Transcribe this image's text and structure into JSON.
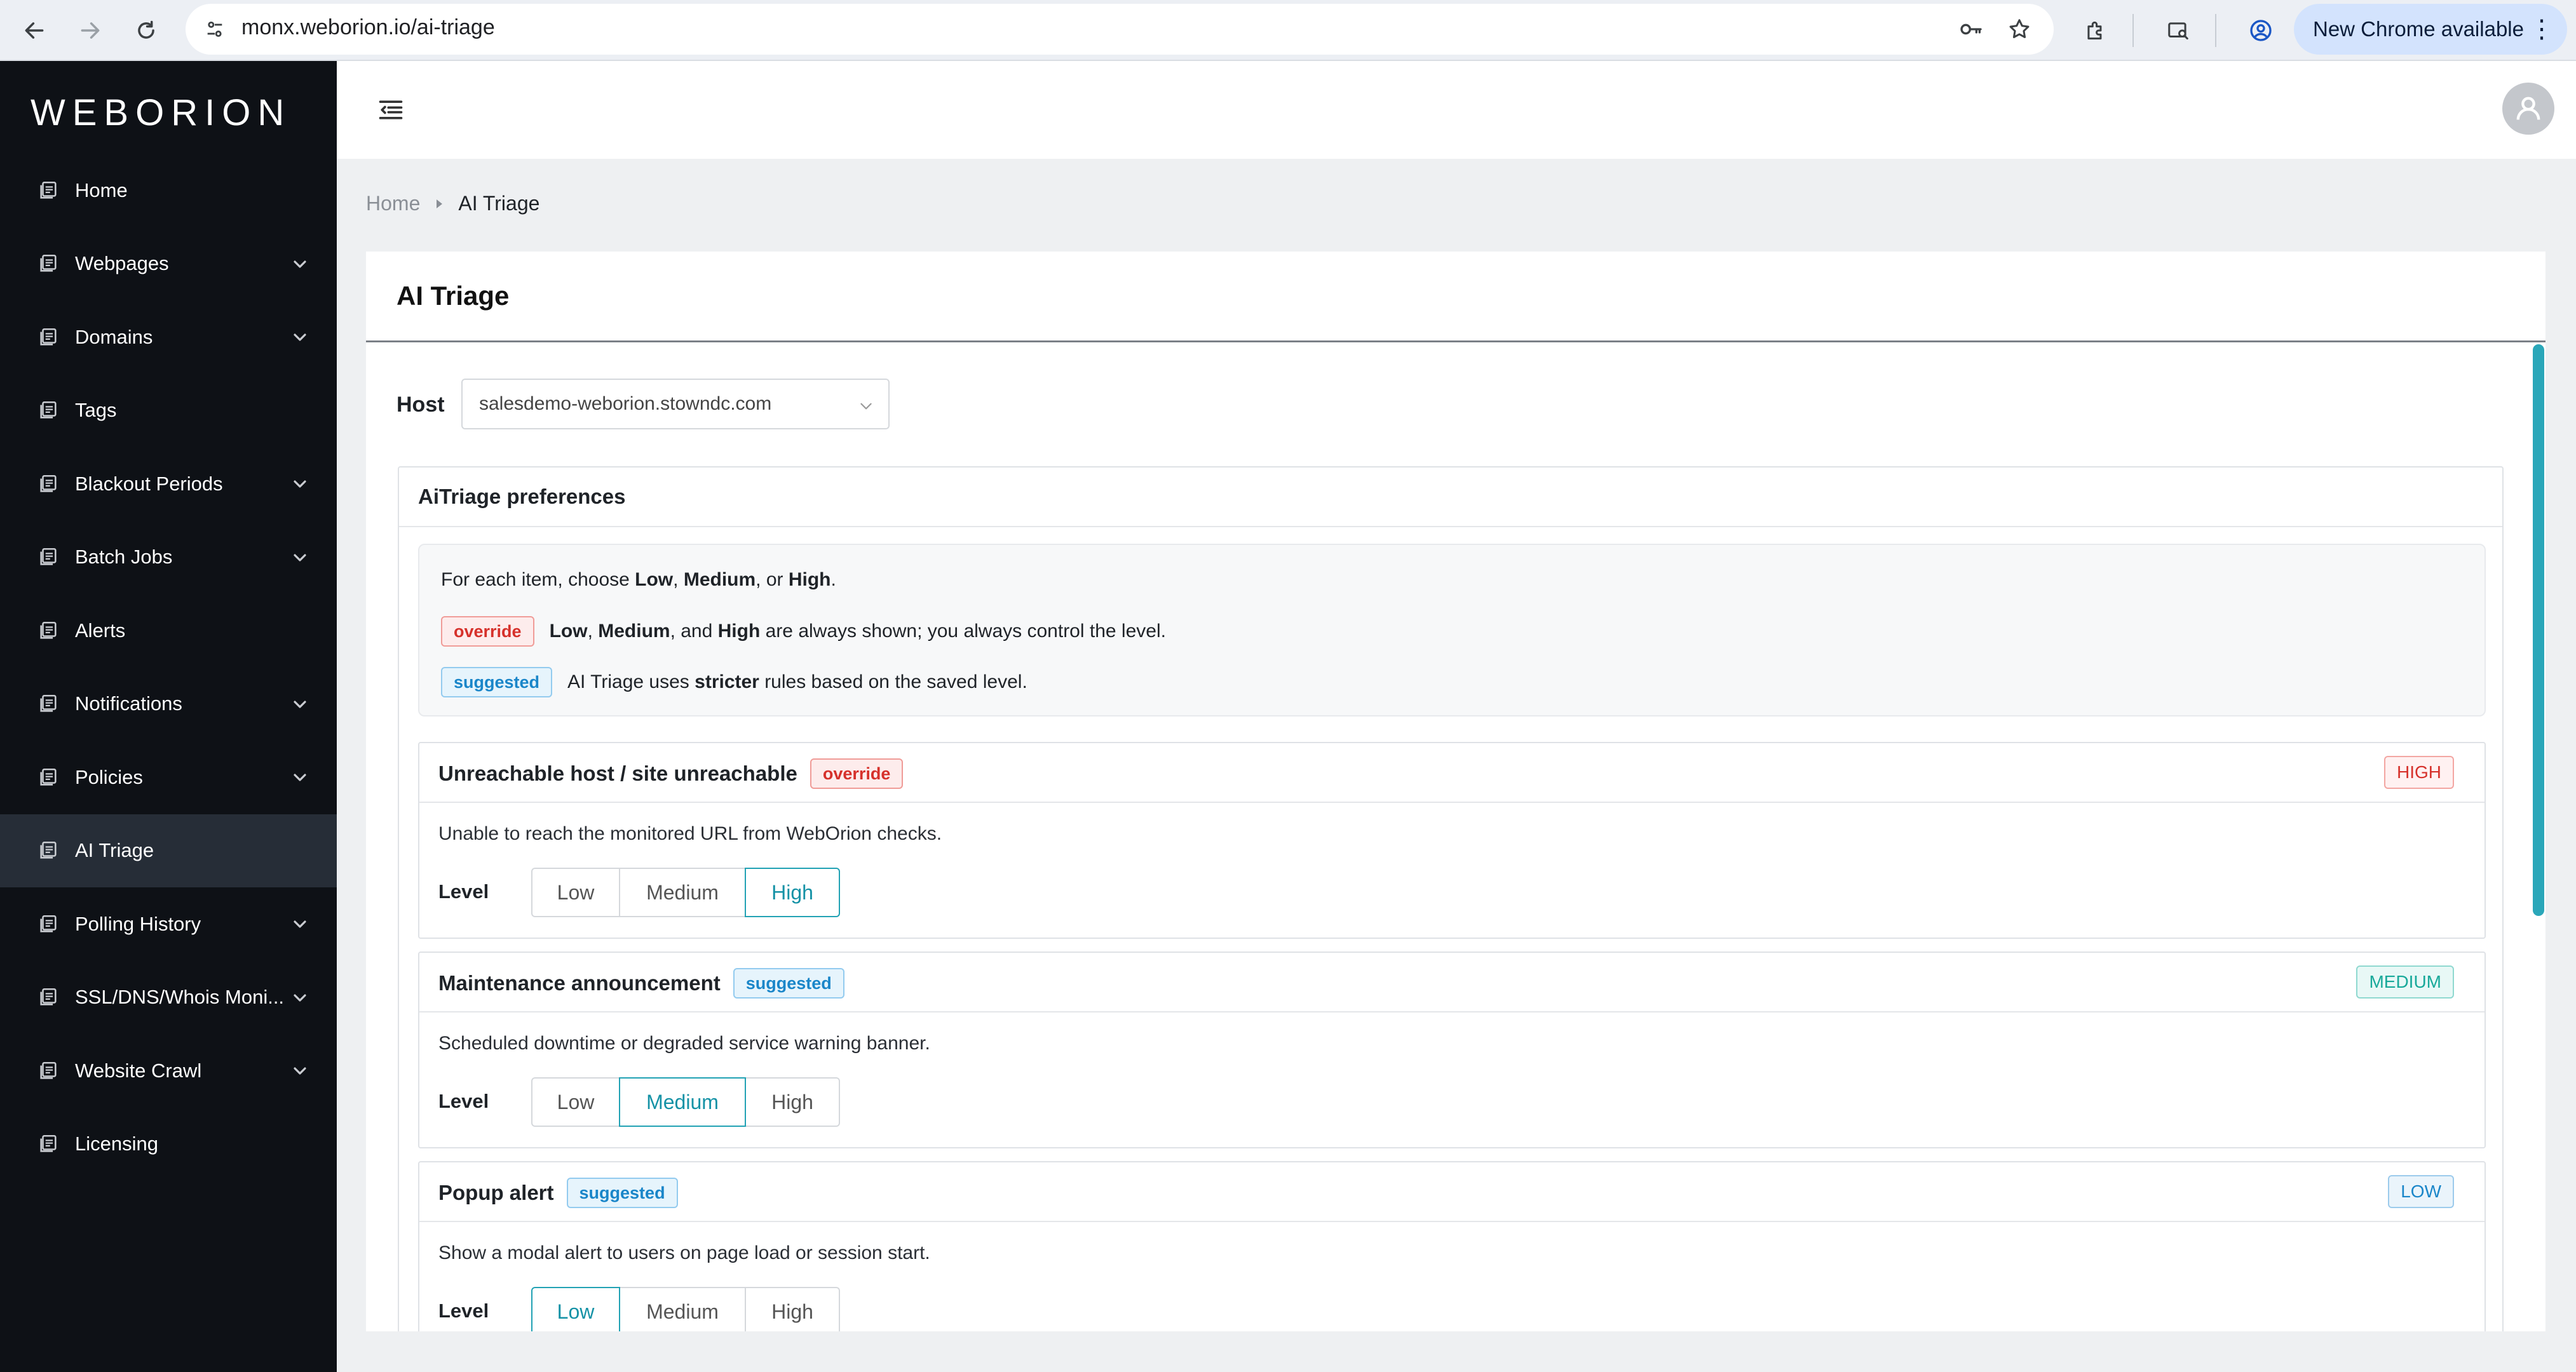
{
  "browser": {
    "url": "monx.weborion.io/ai-triage",
    "update_label": "New Chrome available"
  },
  "sidebar": {
    "brand": "WEBORION",
    "items": [
      {
        "label": "Home",
        "has_children": false
      },
      {
        "label": "Webpages",
        "has_children": true
      },
      {
        "label": "Domains",
        "has_children": true
      },
      {
        "label": "Tags",
        "has_children": false
      },
      {
        "label": "Blackout Periods",
        "has_children": true
      },
      {
        "label": "Batch Jobs",
        "has_children": true
      },
      {
        "label": "Alerts",
        "has_children": false
      },
      {
        "label": "Notifications",
        "has_children": true
      },
      {
        "label": "Policies",
        "has_children": true
      },
      {
        "label": "AI Triage",
        "has_children": false,
        "active": true
      },
      {
        "label": "Polling History",
        "has_children": true
      },
      {
        "label": "SSL/DNS/Whois Moni...",
        "has_children": true
      },
      {
        "label": "Website Crawl",
        "has_children": true
      },
      {
        "label": "Licensing",
        "has_children": false
      }
    ]
  },
  "breadcrumb": {
    "home": "Home",
    "current": "AI Triage"
  },
  "page": {
    "title": "AI Triage",
    "host_label": "Host",
    "host_value": "salesdemo-weborion.stowndc.com"
  },
  "prefs": {
    "title": "AiTriage preferences",
    "info": {
      "intro_prefix": "For each item, choose ",
      "low": "Low",
      "comma": ", ",
      "medium": "Medium",
      "or": ", or ",
      "high": "High",
      "period": ".",
      "override_badge": "override",
      "override_and": ", and ",
      "override_tail": " are always shown; you always control the level.",
      "suggested_badge": "suggested",
      "suggested_prefix": "AI Triage uses ",
      "suggested_bold": "stricter",
      "suggested_tail": " rules based on the saved level."
    },
    "level_label": "Level",
    "options": [
      "Low",
      "Medium",
      "High"
    ],
    "rules": [
      {
        "title": "Unreachable host / site unreachable",
        "badge": "override",
        "level_badge": "HIGH",
        "description": "Unable to reach the monitored URL from WebOrion checks.",
        "selected": "High"
      },
      {
        "title": "Maintenance announcement",
        "badge": "suggested",
        "level_badge": "MEDIUM",
        "description": "Scheduled downtime or degraded service warning banner.",
        "selected": "Medium"
      },
      {
        "title": "Popup alert",
        "badge": "suggested",
        "level_badge": "LOW",
        "description": "Show a modal alert to users on page load or session start.",
        "selected": "Low"
      }
    ]
  }
}
